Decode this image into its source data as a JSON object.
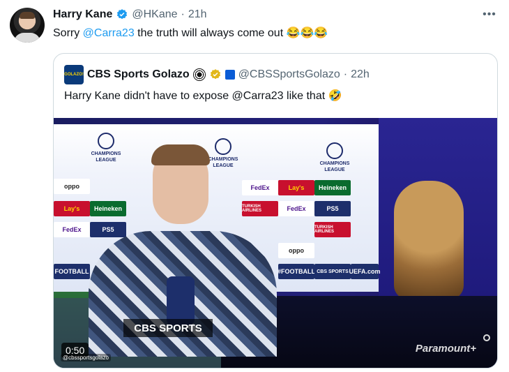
{
  "tweet": {
    "author_name": "Harry Kane",
    "handle": "@HKane",
    "separator": "·",
    "time": "21h",
    "more": "•••",
    "text_before": "Sorry ",
    "mention": "@Carra23",
    "text_after": " the truth will always come out 😂😂😂"
  },
  "quote": {
    "author_name": "CBS Sports Golazo",
    "avatar_label": "GOLAZO!",
    "handle": "@CBSSportsGolazo",
    "separator": "·",
    "time": "22h",
    "text": "Harry Kane didn't have to expose @Carra23 like that 🤣",
    "media": {
      "duration": "0:50",
      "lower_third": "CBS SPORTS",
      "watermark": "@cbssportsgolazo",
      "brand_corner": "Paramount+",
      "backdrop": {
        "league_label_line1": "CHAMPIONS",
        "league_label_line2": "LEAGUE",
        "sponsors": [
          "oppo",
          "FedEx",
          "PS5",
          "Lay's",
          "Heineken",
          "TURKISH AIRLINES",
          "FOOTBALL",
          "#FOOTBALL",
          "CBS SPORTS",
          "UEFA.com"
        ]
      }
    }
  },
  "colors": {
    "link": "#1d9bf0",
    "secondary_text": "#536471",
    "border": "#cfd9de",
    "verified_blue": "#1d9bf0",
    "verified_gold": "#e2b719"
  }
}
